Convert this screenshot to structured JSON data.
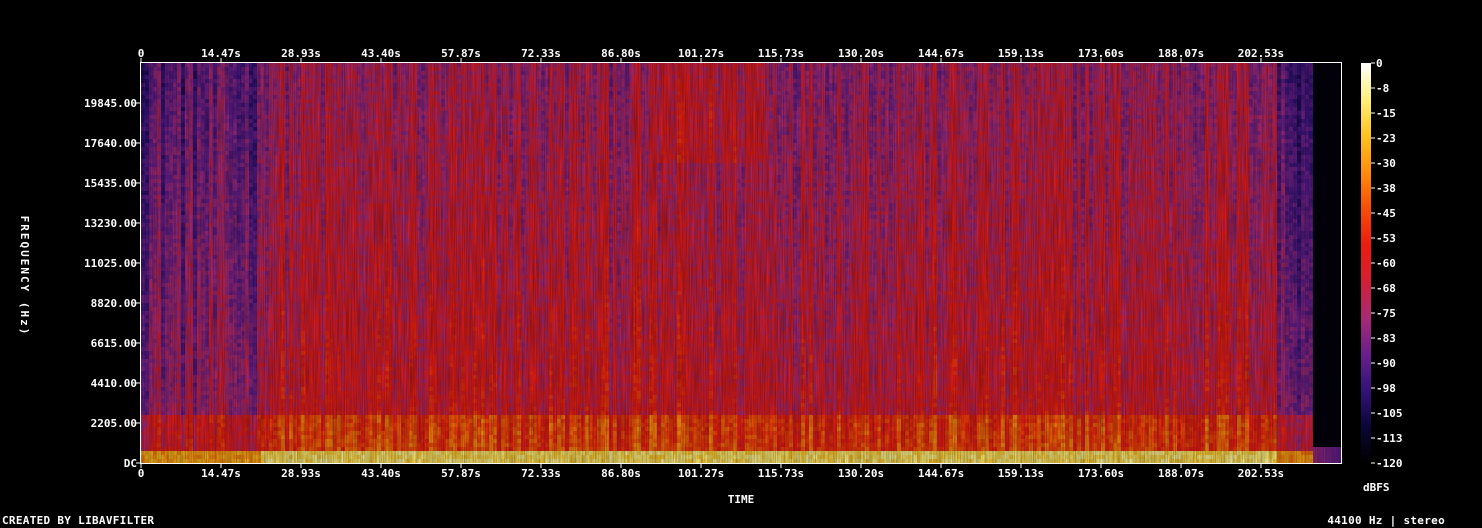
{
  "chart_data": {
    "type": "heatmap",
    "xlabel": "TIME",
    "ylabel": "FREQUENCY (Hz)",
    "x_ticks": [
      "0",
      "14.47s",
      "28.93s",
      "43.40s",
      "57.87s",
      "72.33s",
      "86.80s",
      "101.27s",
      "115.73s",
      "130.20s",
      "144.67s",
      "159.13s",
      "173.60s",
      "188.07s",
      "202.53s"
    ],
    "x_tick_values": [
      0,
      14.47,
      28.93,
      43.4,
      57.87,
      72.33,
      86.8,
      101.27,
      115.73,
      130.2,
      144.67,
      159.13,
      173.6,
      188.07,
      202.53
    ],
    "xlim": [
      0,
      217
    ],
    "audio_end_s": 212,
    "y_ticks": [
      "DC",
      "2205.00",
      "4410.00",
      "6615.00",
      "8820.00",
      "11025.00",
      "13230.00",
      "15435.00",
      "17640.00",
      "19845.00"
    ],
    "y_tick_values": [
      0,
      2205,
      4410,
      6615,
      8820,
      11025,
      13230,
      15435,
      17640,
      19845
    ],
    "ylim": [
      0,
      22050
    ],
    "colorbar": {
      "label": "dBFS",
      "ticks": [
        "0",
        "-8",
        "-15",
        "-23",
        "-30",
        "-38",
        "-45",
        "-53",
        "-60",
        "-68",
        "-75",
        "-83",
        "-90",
        "-98",
        "-105",
        "-113",
        "-120"
      ],
      "range": [
        -120,
        0
      ],
      "colormap": [
        "#000000",
        "#0b0636",
        "#33127a",
        "#6a1f8c",
        "#a82a75",
        "#d41e35",
        "#ed1c10",
        "#f84d08",
        "#fd8d0c",
        "#ffc31f",
        "#fff07a",
        "#ffffff"
      ]
    }
  },
  "footer": {
    "left": "CREATED BY LIBAVFILTER",
    "right": "44100 Hz | stereo"
  }
}
